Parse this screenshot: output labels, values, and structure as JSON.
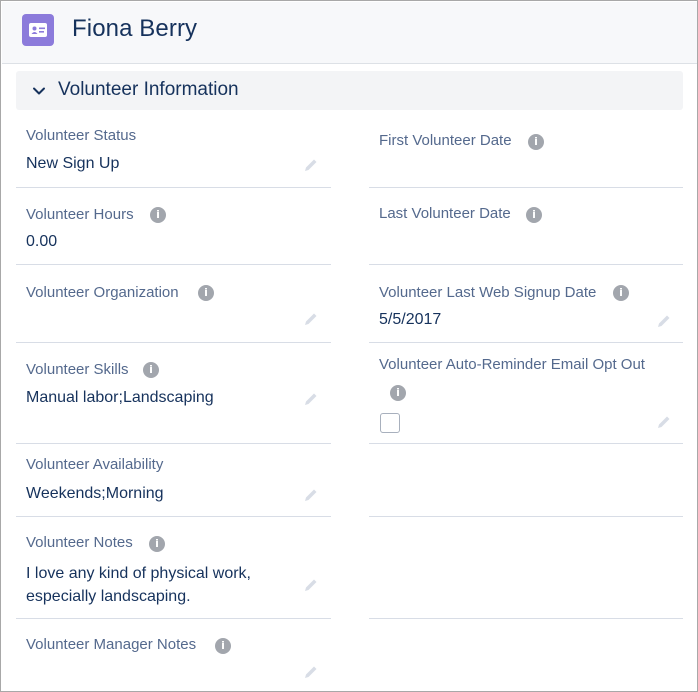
{
  "header": {
    "title": "Fiona Berry",
    "icon": "contact-card-icon"
  },
  "section": {
    "title": "Volunteer Information",
    "icon": "chevron-down-icon"
  },
  "fields": {
    "status": {
      "label": "Volunteer Status",
      "value": "New Sign Up"
    },
    "first_date": {
      "label": "First Volunteer Date",
      "value": ""
    },
    "hours": {
      "label": "Volunteer Hours",
      "value": "0.00"
    },
    "last_date": {
      "label": "Last Volunteer Date",
      "value": ""
    },
    "organization": {
      "label": "Volunteer Organization",
      "value": ""
    },
    "web_signup": {
      "label": "Volunteer Last Web Signup Date",
      "value": "5/5/2017"
    },
    "skills": {
      "label": "Volunteer Skills",
      "value": "Manual labor;Landscaping"
    },
    "auto_reminder": {
      "label": "Volunteer Auto-Reminder Email Opt Out",
      "checked": false
    },
    "availability": {
      "label": "Volunteer Availability",
      "value": "Weekends;Morning"
    },
    "notes": {
      "label": "Volunteer Notes",
      "value": "I love any kind of physical work, especially landscaping."
    },
    "manager_notes": {
      "label": "Volunteer Manager Notes",
      "value": ""
    }
  },
  "colors": {
    "accent": "#8c7bdb",
    "text": "#16325c",
    "label": "#54698d",
    "divider": "#d8dde6"
  }
}
